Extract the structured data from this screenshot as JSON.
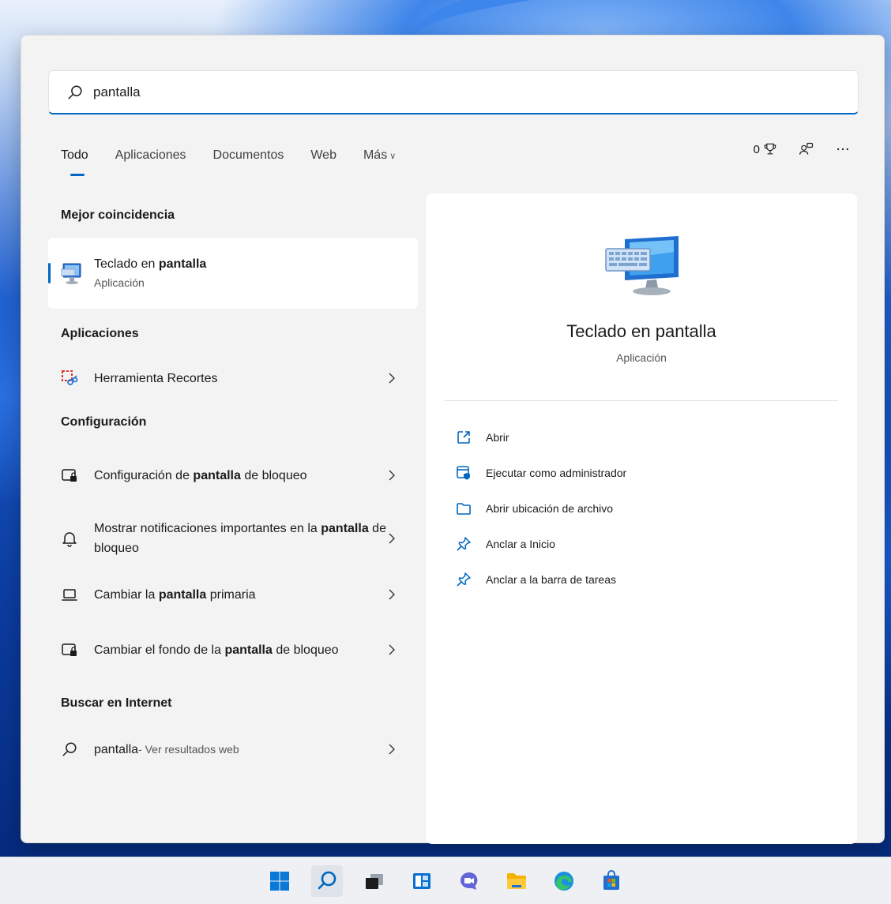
{
  "search": {
    "value": "pantalla",
    "placeholder": ""
  },
  "tabs": [
    {
      "label": "Todo",
      "active": true
    },
    {
      "label": "Aplicaciones"
    },
    {
      "label": "Documentos"
    },
    {
      "label": "Web"
    },
    {
      "label": "Más"
    }
  ],
  "toolbar": {
    "points": "0"
  },
  "best_match": {
    "section": "Mejor coincidencia",
    "title_pre": "Teclado en ",
    "title_bold": "pantalla",
    "subtitle": "Aplicación"
  },
  "apps": {
    "section": "Aplicaciones",
    "items": [
      {
        "label": "Herramienta Recortes"
      }
    ]
  },
  "settings": {
    "section": "Configuración",
    "items": [
      {
        "pre": "Configuración de ",
        "bold": "pantalla",
        "post": " de bloqueo"
      },
      {
        "pre": "Mostrar notificaciones importantes en la ",
        "bold": "pantalla",
        "post": " de bloqueo"
      },
      {
        "pre": "Cambiar la ",
        "bold": "pantalla",
        "post": " primaria"
      },
      {
        "pre": "Cambiar el fondo de la ",
        "bold": "pantalla",
        "post": " de bloqueo"
      }
    ]
  },
  "web": {
    "section": "Buscar en Internet",
    "query": "pantalla",
    "suffix": " - Ver resultados web"
  },
  "preview": {
    "title": "Teclado en pantalla",
    "subtitle": "Aplicación",
    "actions": [
      {
        "label": "Abrir"
      },
      {
        "label": "Ejecutar como administrador"
      },
      {
        "label": "Abrir ubicación de archivo"
      },
      {
        "label": "Anclar a Inicio"
      },
      {
        "label": "Anclar a la barra de tareas"
      }
    ]
  },
  "colors": {
    "accent": "#0067c0"
  }
}
